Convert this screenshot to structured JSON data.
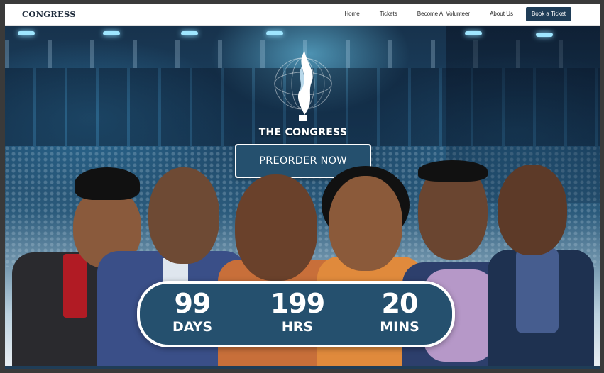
{
  "nav": {
    "brand": "CONGRESS",
    "links": [
      "Home",
      "Tickets",
      "Become A  Volunteer",
      "About Us"
    ],
    "cta": "Book a Ticket"
  },
  "hero": {
    "logo_title": "THE CONGRESS",
    "preorder_label": "PREORDER NOW",
    "countdown": [
      {
        "value": "99",
        "label": "DAYS"
      },
      {
        "value": "199",
        "label": "HRS"
      },
      {
        "value": "20",
        "label": "MINS"
      }
    ]
  },
  "colors": {
    "primary": "#25506e",
    "nav_cta": "#1f3d57",
    "white": "#ffffff"
  }
}
